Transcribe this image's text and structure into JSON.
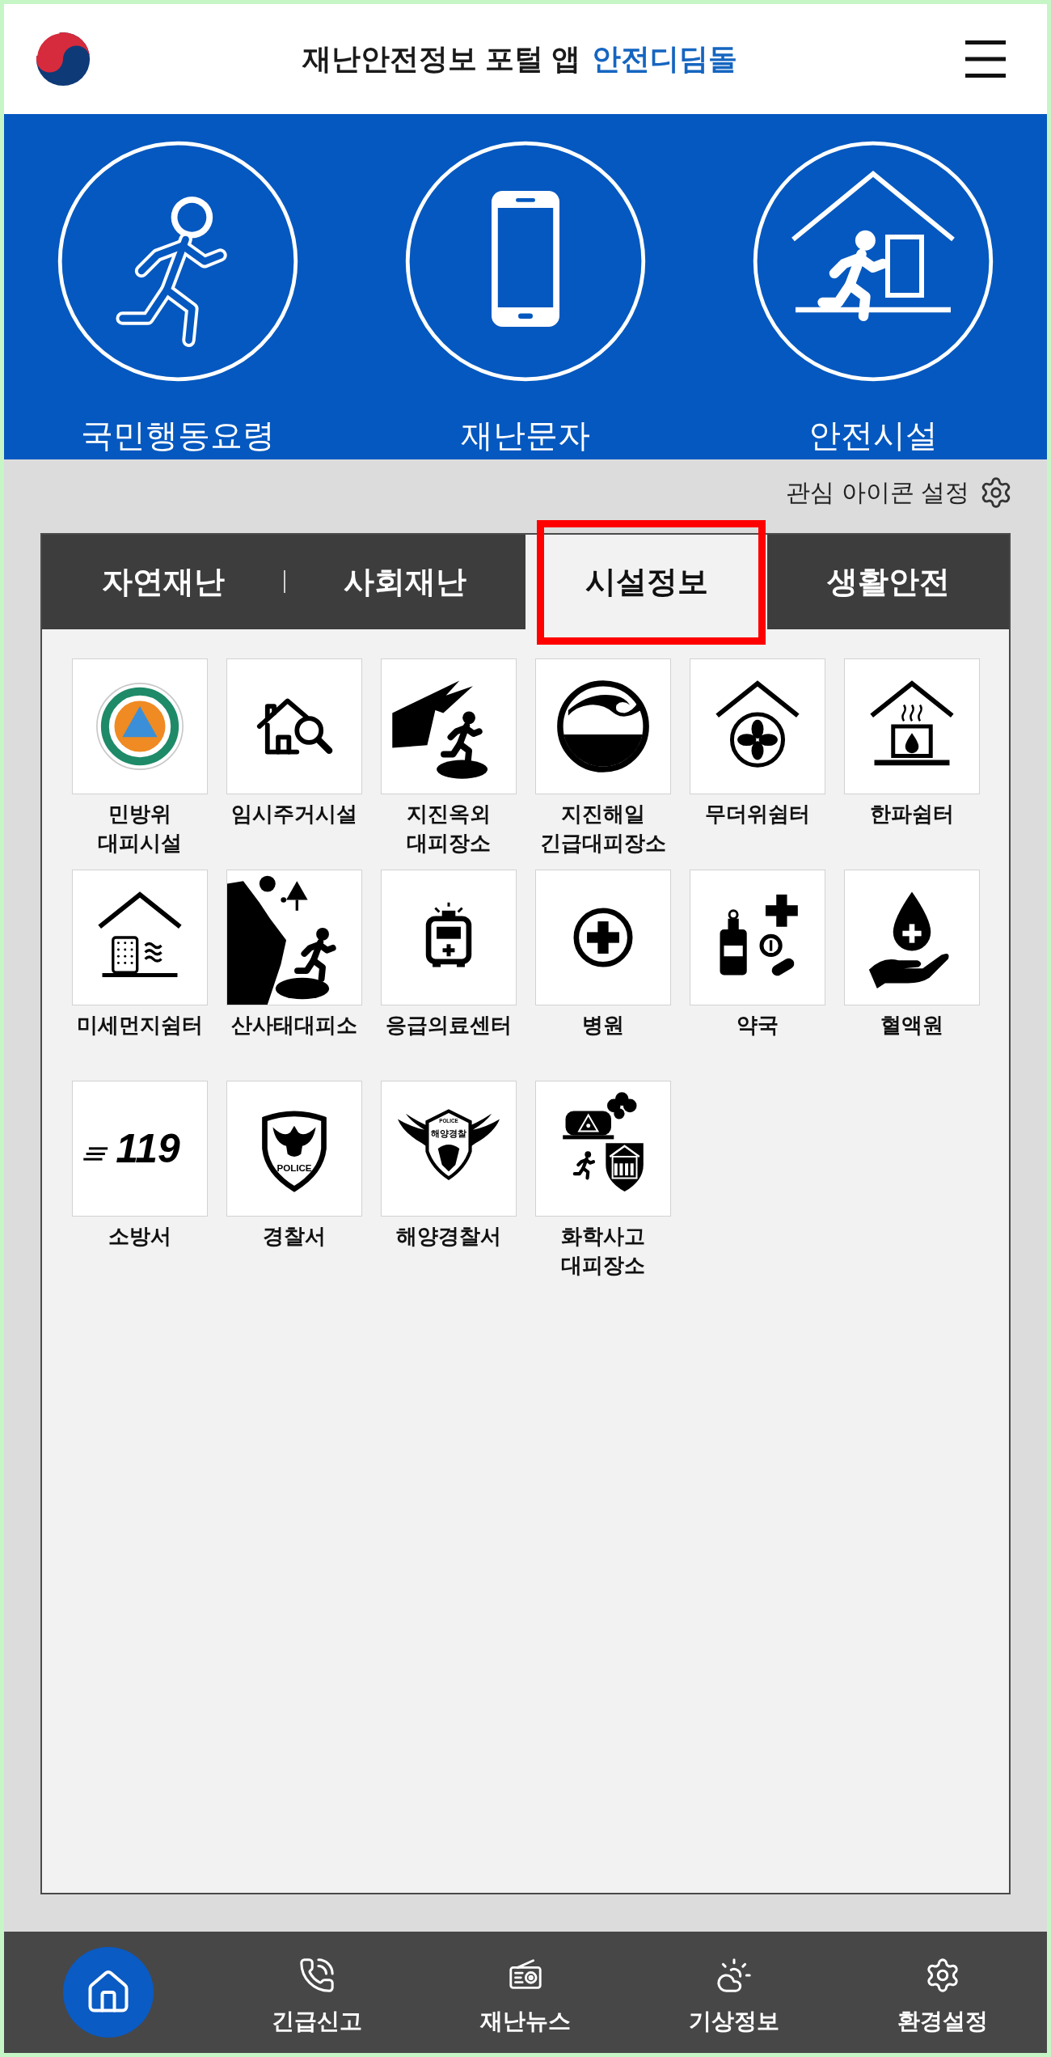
{
  "header": {
    "title": "재난안전정보 포털 앱",
    "brand": "안전디딤돌"
  },
  "hero_menu": [
    {
      "label": "국민행동요령"
    },
    {
      "label": "재난문자"
    },
    {
      "label": "안전시설"
    }
  ],
  "interest_settings": {
    "label": "관심 아이콘 설정"
  },
  "tabs": [
    {
      "label": "자연재난",
      "selected": false,
      "highlighted": false
    },
    {
      "label": "사회재난",
      "selected": false,
      "highlighted": false
    },
    {
      "label": "시설정보",
      "selected": true,
      "highlighted": true
    },
    {
      "label": "생활안전",
      "selected": false,
      "highlighted": false
    }
  ],
  "facilities": [
    {
      "label": "민방위 대피시설"
    },
    {
      "label": "임시주거시설"
    },
    {
      "label": "지진옥외 대피장소"
    },
    {
      "label": "지진해일 긴급대피장소"
    },
    {
      "label": "무더위쉼터"
    },
    {
      "label": "한파쉼터"
    },
    {
      "label": "미세먼지쉼터"
    },
    {
      "label": "산사태대피소"
    },
    {
      "label": "응급의료센터"
    },
    {
      "label": "병원"
    },
    {
      "label": "약국"
    },
    {
      "label": "혈액원"
    },
    {
      "label": "소방서",
      "emblem_texts": [
        "119"
      ]
    },
    {
      "label": "경찰서",
      "emblem_texts": [
        "POLICE"
      ]
    },
    {
      "label": "해양경찰서",
      "emblem_texts": [
        "POLICE",
        "해양경찰"
      ]
    },
    {
      "label": "화학사고 대피장소"
    }
  ],
  "bottom_nav": [
    {
      "selected": true
    },
    {
      "label": "긴급신고",
      "selected": false
    },
    {
      "label": "재난뉴스",
      "selected": false
    },
    {
      "label": "기상정보",
      "selected": false
    },
    {
      "label": "환경설정",
      "selected": false
    }
  ]
}
